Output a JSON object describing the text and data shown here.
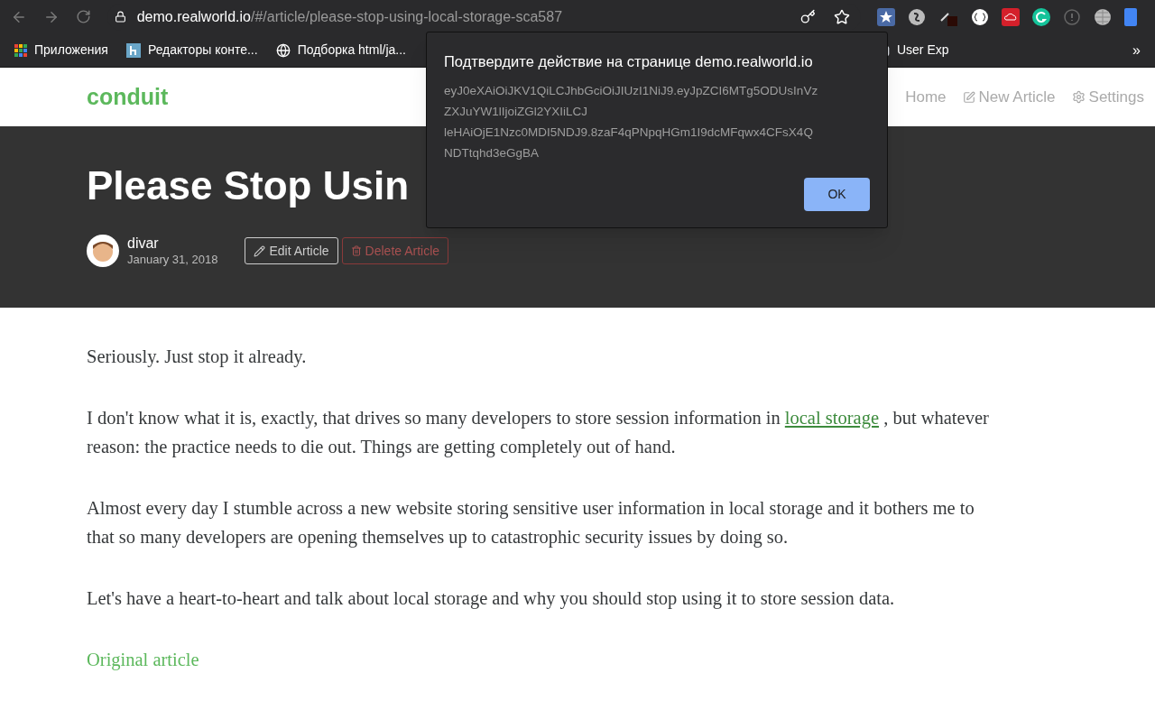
{
  "browser": {
    "url_host": "demo.realworld.io",
    "url_path": "/#/article/please-stop-using-local-storage-sca587"
  },
  "bookmarks": [
    {
      "kind": "apps",
      "label": "Приложения"
    },
    {
      "kind": "h",
      "label": "Редакторы конте..."
    },
    {
      "kind": "globe",
      "label": "Подборка html/ja..."
    },
    {
      "kind": "folder",
      "label": "User Exp"
    }
  ],
  "bookmarks_more": "»",
  "navbar": {
    "brand": "conduit",
    "links": [
      {
        "kind": "home",
        "label": "Home"
      },
      {
        "kind": "edit",
        "label": "New Article"
      },
      {
        "kind": "gear",
        "label": "Settings"
      }
    ]
  },
  "banner": {
    "title": "Please Stop Usin",
    "author": "divar",
    "date": "January 31, 2018",
    "actions": [
      {
        "kind": "edit",
        "label": "Edit Article"
      },
      {
        "kind": "delete",
        "label": "Delete Article"
      }
    ]
  },
  "paragraphs": [
    {
      "lines": [
        [
          "Seriously. Just stop it already."
        ]
      ]
    },
    {
      "lines": [
        [
          "I don't know what it is, exactly, that drives so many developers to store session information in ",
          {
            "link": "local storage"
          },
          " , but whatever"
        ],
        [
          "reason: the practice needs to die out. Things are getting completely out of hand."
        ]
      ]
    },
    {
      "lines": [
        [
          "Almost every day I stumble across a new website storing sensitive user information in local storage and it bothers me to"
        ],
        [
          "that so many developers are opening themselves up to catastrophic security issues by doing so."
        ]
      ]
    },
    {
      "lines": [
        [
          "Let's have a heart-to-heart and talk about local storage and why you should stop using it to store session data."
        ]
      ]
    }
  ],
  "original_link": "Original article",
  "dialog": {
    "title": "Подтвердите действие на странице demo.realworld.io",
    "lines": [
      "eyJ0eXAiOiJKV1QiLCJhbGciOiJIUzI1NiJ9.eyJpZCI6MTg5ODUsInVz",
      "ZXJuYW1lIjoiZGl2YXIiLCJ",
      "leHAiOjE1Nzc0MDI5NDJ9.8zaF4qPNpqHGm1I9dcMFqwx4CFsX4Q",
      "NDTtqhd3eGgBA"
    ],
    "ok": "OK"
  }
}
